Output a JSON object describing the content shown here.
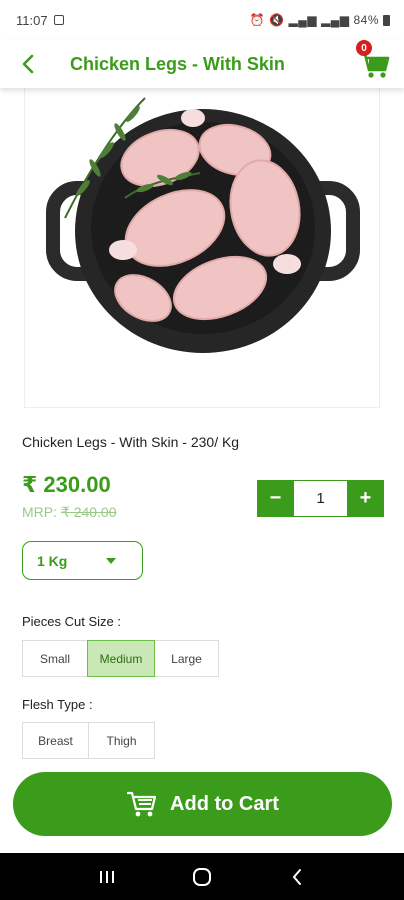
{
  "status_bar": {
    "time": "11:07",
    "battery": "84%"
  },
  "header": {
    "title": "Chicken Legs - With Skin",
    "cart_count": "0"
  },
  "product": {
    "name_line": "Chicken Legs - With Skin - 230/ Kg",
    "price": "₹ 230.00",
    "mrp_label": "MRP:",
    "mrp_value": "₹ 240.00",
    "quantity": "1",
    "minus_label": "−",
    "plus_label": "+",
    "weight_selected": "1 Kg"
  },
  "pieces_cut": {
    "label": "Pieces Cut Size :",
    "options": [
      "Small",
      "Medium",
      "Large"
    ],
    "selected": "Medium"
  },
  "flesh_type": {
    "label": "Flesh Type :",
    "options": [
      "Breast",
      "Thigh"
    ]
  },
  "add_to_cart_label": "Add to Cart",
  "colors": {
    "accent": "#3b9c1b",
    "selected_bg": "#c9e8b6",
    "badge": "#d32020"
  }
}
